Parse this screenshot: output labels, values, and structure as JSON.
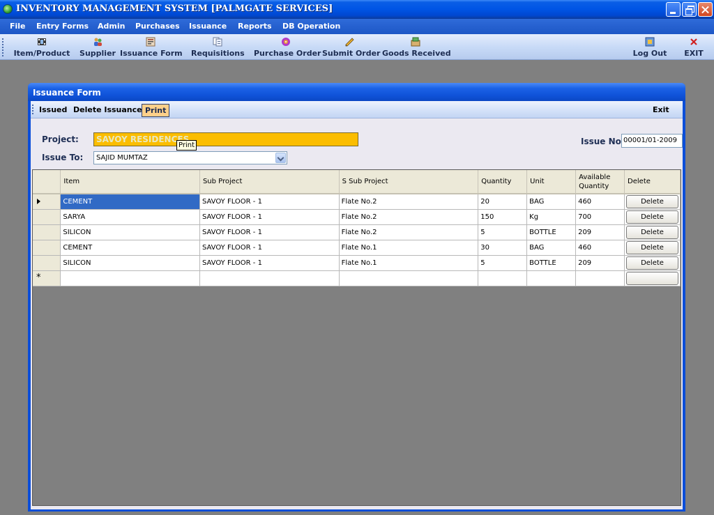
{
  "window": {
    "title": "INVENTORY MANAGEMENT SYSTEM [PALMGATE SERVICES]"
  },
  "menu": [
    "File",
    "Entry Forms",
    "Admin",
    "Purchases",
    "Issuance",
    "Reports",
    "DB Operation"
  ],
  "toolbar": {
    "items": [
      {
        "label": "Item/Product",
        "icon": "film-icon"
      },
      {
        "label": "Supplier",
        "icon": "people-icon"
      },
      {
        "label": "Issuance Form",
        "icon": "form-icon"
      },
      {
        "label": "Requisitions",
        "icon": "documents-icon"
      },
      {
        "label": "Purchase Order",
        "icon": "disc-icon"
      },
      {
        "label": "Submit Order",
        "icon": "pencil-icon"
      },
      {
        "label": "Goods Received",
        "icon": "package-icon"
      },
      {
        "label": "Log Out",
        "icon": "logout-icon"
      },
      {
        "label": "EXIT",
        "icon": "close-x-icon"
      }
    ]
  },
  "form": {
    "title": "Issuance Form",
    "actions": {
      "issued": "Issued",
      "delete_issuance": "Delete Issuance",
      "print": "Print",
      "exit": "Exit"
    },
    "tooltip": "Print",
    "project_label": "Project:",
    "project_value": "SAVOY RESIDENCES",
    "issue_to_label": "Issue To:",
    "issue_to_value": "SAJID MUMTAZ",
    "issue_no_label": "Issue No:",
    "issue_no_value": "00001/01-2009"
  },
  "grid": {
    "columns": [
      "Item",
      "Sub Project",
      "S Sub Project",
      "Quantity",
      "Unit",
      "Available Quantity",
      "Delete"
    ],
    "rows": [
      {
        "item": "CEMENT",
        "sub_project": "SAVOY FLOOR - 1",
        "s_sub_project": "Flate No.2",
        "quantity": "20",
        "unit": "BAG",
        "available": "460",
        "delete": "Delete"
      },
      {
        "item": "SARYA",
        "sub_project": "SAVOY FLOOR - 1",
        "s_sub_project": "Flate No.2",
        "quantity": "150",
        "unit": "Kg",
        "available": "700",
        "delete": "Delete"
      },
      {
        "item": "SILICON",
        "sub_project": "SAVOY FLOOR - 1",
        "s_sub_project": "Flate No.2",
        "quantity": "5",
        "unit": "BOTTLE",
        "available": "209",
        "delete": "Delete"
      },
      {
        "item": "CEMENT",
        "sub_project": "SAVOY FLOOR - 1",
        "s_sub_project": "Flate No.1",
        "quantity": "30",
        "unit": "BAG",
        "available": "460",
        "delete": "Delete"
      },
      {
        "item": "SILICON",
        "sub_project": "SAVOY FLOOR - 1",
        "s_sub_project": "Flate No.1",
        "quantity": "5",
        "unit": "BOTTLE",
        "available": "209",
        "delete": "Delete"
      }
    ],
    "new_row_marker": "*"
  },
  "colors": {
    "titlebar": "#0055e5",
    "project_field": "#fbbd00",
    "selected_cell": "#316ac5",
    "workspace": "#808080"
  }
}
